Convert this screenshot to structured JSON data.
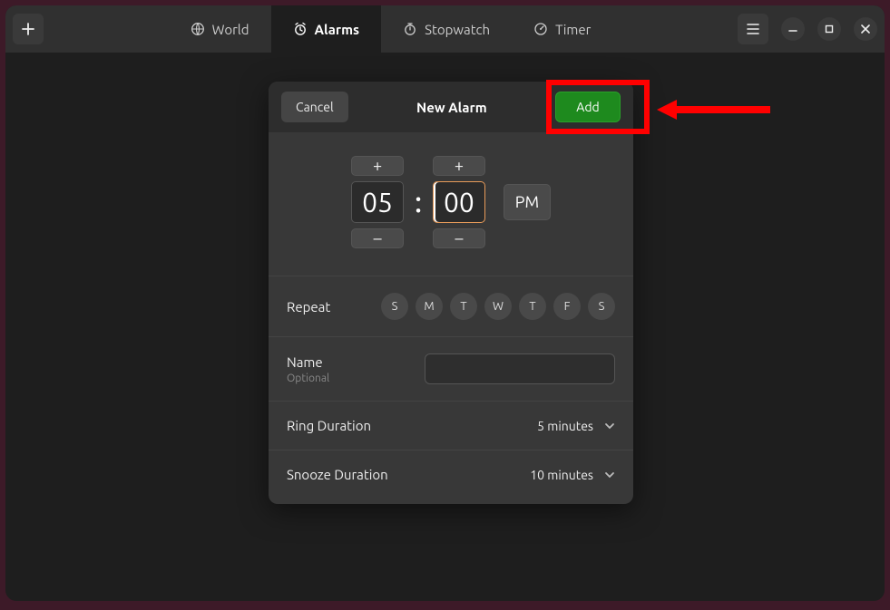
{
  "titlebar": {
    "tabs": {
      "world": "World",
      "alarms": "Alarms",
      "stopwatch": "Stopwatch",
      "timer": "Timer"
    }
  },
  "dialog": {
    "cancel": "Cancel",
    "title": "New Alarm",
    "add": "Add",
    "time": {
      "hour": "05",
      "minute": "00",
      "ampm": "PM",
      "plus": "+",
      "minus": "–",
      "sep": ":"
    },
    "repeat": {
      "label": "Repeat",
      "days": [
        "S",
        "M",
        "T",
        "W",
        "T",
        "F",
        "S"
      ]
    },
    "name": {
      "label": "Name",
      "hint": "Optional",
      "value": ""
    },
    "ring": {
      "label": "Ring Duration",
      "value": "5 minutes"
    },
    "snooze": {
      "label": "Snooze Duration",
      "value": "10 minutes"
    }
  }
}
